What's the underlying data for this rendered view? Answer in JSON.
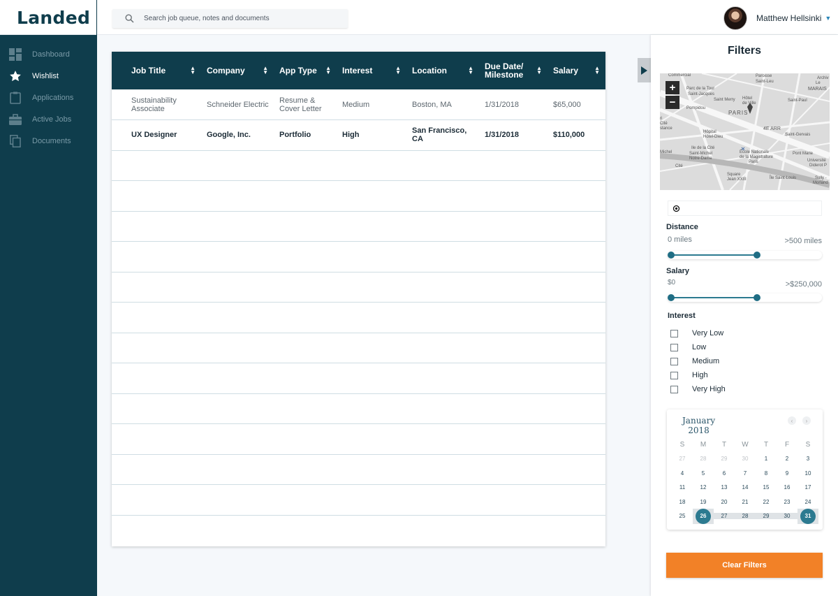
{
  "app": {
    "logo": "Landed"
  },
  "search": {
    "placeholder": "Search job queue, notes and documents"
  },
  "user": {
    "name": "Matthew Hellsinki"
  },
  "sidebar": {
    "items": [
      {
        "label": "Dashboard",
        "icon": "dashboard-icon"
      },
      {
        "label": "Wishlist",
        "icon": "star-icon",
        "active": true
      },
      {
        "label": "Applications",
        "icon": "clipboard-icon"
      },
      {
        "label": "Active Jobs",
        "icon": "briefcase-icon"
      },
      {
        "label": "Documents",
        "icon": "documents-icon"
      }
    ]
  },
  "table": {
    "columns": [
      "Job Title",
      "Company",
      "App Type",
      "Interest",
      "Location",
      "Due Date/ Milestone",
      "Salary"
    ],
    "rows": [
      {
        "title": "Sustainability Associate",
        "company": "Schneider Electric",
        "app_type": "Resume & Cover Letter",
        "interest": "Medium",
        "location": "Boston, MA",
        "due": "1/31/2018",
        "salary": "$65,000"
      },
      {
        "title": "UX Designer",
        "company": "Google, Inc.",
        "app_type": "Portfolio",
        "interest": "High",
        "location": "San Francisco, CA",
        "due": "1/31/2018",
        "salary": "$110,000"
      }
    ]
  },
  "filters": {
    "title": "Filters",
    "map": {
      "labels": [
        "Commercial",
        "Paroisse",
        "Saint-Leu",
        "Archiv",
        "Le",
        "MARAIS",
        "Parc de la Tour",
        "Saint-Jacques",
        "Saint Merry",
        "Hôtel",
        "de Ville",
        "Saint-Paul",
        "Pompidou",
        "PARIS",
        "4E ARR",
        "Saint-Gervais",
        "Hôpital",
        "Hôtel-Dieu",
        "École Nationale",
        "de la Magistrature",
        "Paris",
        "Saint-Michel",
        "Notre-Dame",
        "Square",
        "Jean XXIII",
        "Île Saint-Louis",
        "Sully -",
        "Morland",
        "Université",
        "Diderot P",
        "Pont Marie",
        "Michel",
        "ri",
        "Cité",
        "stance",
        "Ile de la Cité",
        "Cité"
      ]
    },
    "distance": {
      "label": "Distance",
      "min": "0 miles",
      "max": ">500 miles",
      "low": 0,
      "high": 0.6
    },
    "salary": {
      "label": "Salary",
      "min": "$0",
      "max": ">$250,000",
      "low": 0,
      "high": 0.6
    },
    "interest": {
      "label": "Interest",
      "options": [
        "Very Low",
        "Low",
        "Medium",
        "High",
        "Very High"
      ]
    },
    "calendar": {
      "month": "January",
      "year": "2018",
      "weekdays": [
        "S",
        "M",
        "T",
        "W",
        "T",
        "F",
        "S"
      ],
      "weeks": [
        [
          "27",
          "28",
          "29",
          "30",
          "1",
          "2",
          "3"
        ],
        [
          "4",
          "5",
          "6",
          "7",
          "8",
          "9",
          "10"
        ],
        [
          "11",
          "12",
          "13",
          "14",
          "15",
          "16",
          "17"
        ],
        [
          "18",
          "19",
          "20",
          "21",
          "22",
          "23",
          "24"
        ],
        [
          "25",
          "26",
          "27",
          "28",
          "29",
          "30",
          "31"
        ]
      ],
      "selected_start": "26",
      "selected_end": "31"
    },
    "clear_label": "Clear Filters"
  },
  "colors": {
    "brand": "#0f3d4c",
    "accent": "#2c7a90",
    "button": "#f28127"
  }
}
